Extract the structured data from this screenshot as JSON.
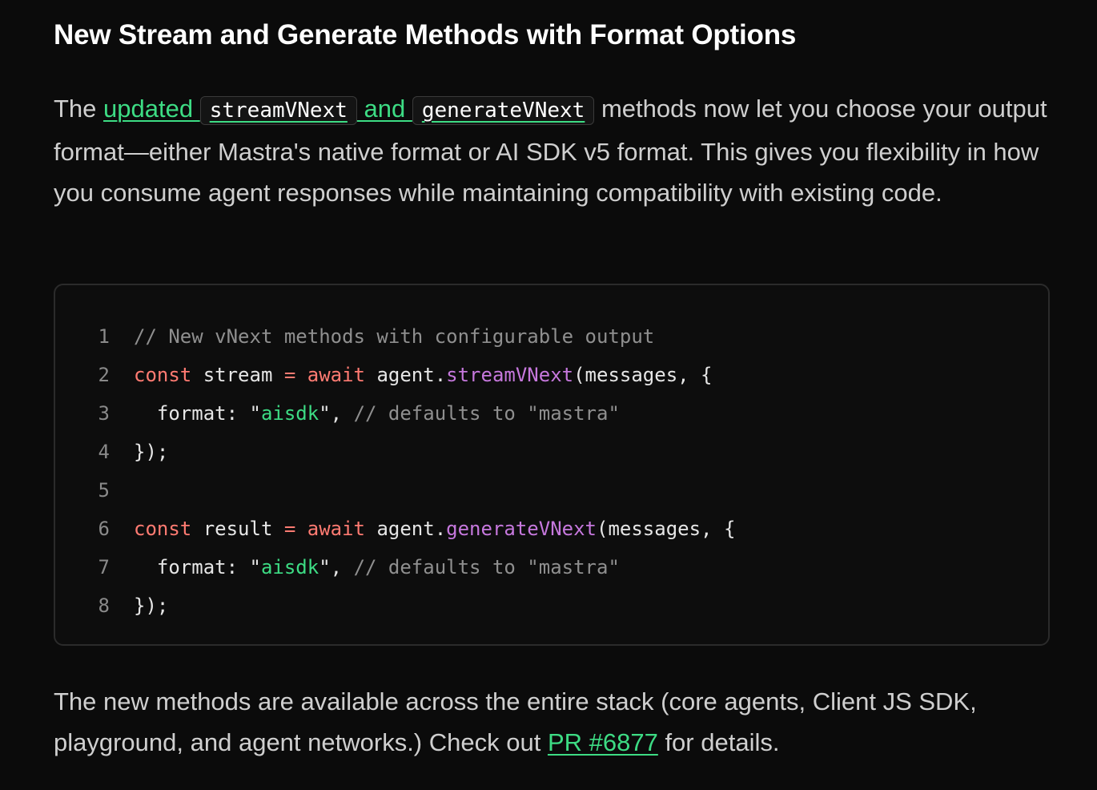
{
  "heading": "New Stream and Generate Methods with Format Options",
  "intro": {
    "the": "The ",
    "link_updated": "updated ",
    "code_stream": "streamVNext",
    "link_and": " and ",
    "code_generate": "generateVNext",
    "rest": " methods now let you choose your output format—either Mastra's native format or AI SDK v5 format. This gives you flexibility in how you consume agent responses while maintaining compatibility with existing code."
  },
  "code": {
    "lines": [
      {
        "num": "1",
        "tokens": [
          {
            "t": "comment",
            "v": "// New vNext methods with configurable output"
          }
        ]
      },
      {
        "num": "2",
        "tokens": [
          {
            "t": "keyword",
            "v": "const"
          },
          {
            "t": "plain",
            "v": " stream "
          },
          {
            "t": "keyword",
            "v": "="
          },
          {
            "t": "plain",
            "v": " "
          },
          {
            "t": "keyword",
            "v": "await"
          },
          {
            "t": "plain",
            "v": " agent."
          },
          {
            "t": "func",
            "v": "streamVNext"
          },
          {
            "t": "plain",
            "v": "(messages, {"
          }
        ]
      },
      {
        "num": "3",
        "tokens": [
          {
            "t": "plain",
            "v": "  format: \""
          },
          {
            "t": "string",
            "v": "aisdk"
          },
          {
            "t": "plain",
            "v": "\", "
          },
          {
            "t": "comment",
            "v": "// defaults to \"mastra\""
          }
        ]
      },
      {
        "num": "4",
        "tokens": [
          {
            "t": "plain",
            "v": "});"
          }
        ]
      },
      {
        "num": "5",
        "tokens": []
      },
      {
        "num": "6",
        "tokens": [
          {
            "t": "keyword",
            "v": "const"
          },
          {
            "t": "plain",
            "v": " result "
          },
          {
            "t": "keyword",
            "v": "="
          },
          {
            "t": "plain",
            "v": " "
          },
          {
            "t": "keyword",
            "v": "await"
          },
          {
            "t": "plain",
            "v": " agent."
          },
          {
            "t": "func",
            "v": "generateVNext"
          },
          {
            "t": "plain",
            "v": "(messages, {"
          }
        ]
      },
      {
        "num": "7",
        "tokens": [
          {
            "t": "plain",
            "v": "  format: \""
          },
          {
            "t": "string",
            "v": "aisdk"
          },
          {
            "t": "plain",
            "v": "\", "
          },
          {
            "t": "comment",
            "v": "// defaults to \"mastra\""
          }
        ]
      },
      {
        "num": "8",
        "tokens": [
          {
            "t": "plain",
            "v": "});"
          }
        ]
      }
    ]
  },
  "outro": {
    "text": "The new methods are available across the entire stack (core agents, Client JS SDK, playground, and agent networks.) Check out ",
    "link": "PR #6877",
    "after": " for details."
  },
  "colors": {
    "background": "#0b0b0b",
    "link": "#3ddc84",
    "keyword": "#ff7b72",
    "function": "#c678dd",
    "string": "#3ddc84",
    "comment": "#8f8f8f"
  }
}
